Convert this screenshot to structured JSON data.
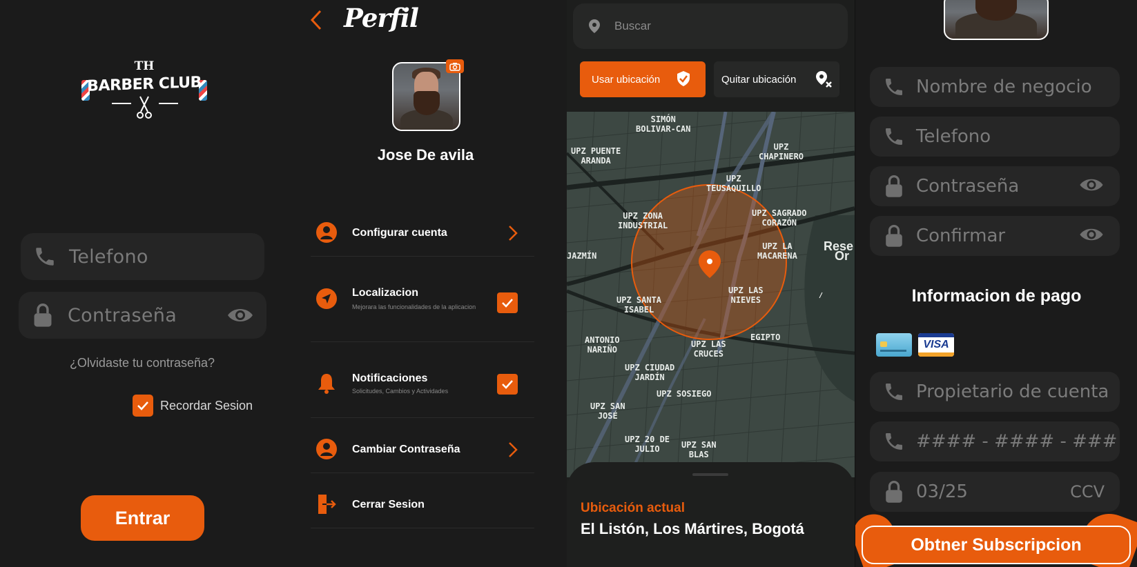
{
  "login": {
    "logo_top": "TH",
    "logo_main": "BARBER CLUB",
    "phone_placeholder": "Telefono",
    "password_placeholder": "Contraseña",
    "forgot_password": "¿Olvidaste tu contraseña?",
    "remember_label": "Recordar Sesion",
    "remember_checked": true,
    "enter_button": "Entrar"
  },
  "profile": {
    "title": "Perfil",
    "user_name": "Jose De avila",
    "menu": [
      {
        "title": "Configurar cuenta",
        "subtitle": "",
        "icon": "user-circle-icon",
        "control": "chevron"
      },
      {
        "title": "Localizacion",
        "subtitle": "Mejorara las funcionalidades de la aplicacion",
        "icon": "navigation-arrow-icon",
        "control": "checkbox",
        "checked": true
      },
      {
        "title": "Notificaciones",
        "subtitle": "Solicitudes, Cambios y Actividades",
        "icon": "bell-icon",
        "control": "checkbox",
        "checked": true
      },
      {
        "title": "Cambiar Contraseña",
        "subtitle": "",
        "icon": "user-circle-icon",
        "control": "chevron"
      },
      {
        "title": "Cerrar Sesion",
        "subtitle": "",
        "icon": "logout-icon",
        "control": "none"
      }
    ]
  },
  "location": {
    "search_placeholder": "Buscar",
    "use_location": "Usar ubicación",
    "remove_location": "Quitar ubicación",
    "map_labels": [
      "SIMÓN BOLIVAR-CAN",
      "UPZ PUENTE ARANDA",
      "UPZ CHAPINERO",
      "UPZ TEUSAQUILLO",
      "UPZ ZONA INDUSTRIAL",
      "UPZ SAGRADO CORAZÓN",
      "UPZ LA MACARENA",
      "JAZMÍN",
      "UPZ SANTA ISABEL",
      "UPZ LAS NIEVES",
      "ANTONIO NARIÑO",
      "UPZ LAS CRUCES",
      "EGIPTO",
      "UPZ CIUDAD JARDÍN",
      "UPZ SOSIEGO",
      "UPZ SAN JOSÉ",
      "UPZ 20 DE JULIO",
      "UPZ SAN BLAS",
      "Rese",
      "Or"
    ],
    "current_label": "Ubicación actual",
    "current_address": "El Listón, Los Mártires, Bogotá"
  },
  "register": {
    "business_placeholder": "Nombre de negocio",
    "phone_placeholder": "Telefono",
    "password_placeholder": "Contraseña",
    "confirm_placeholder": "Confirmar",
    "payment_title": "Informacion de pago",
    "card_brand": "VISA",
    "owner_placeholder": "Propietario de cuenta",
    "card_number_placeholder": "#### - #### - ###",
    "expiry_placeholder": "03/25",
    "ccv_placeholder": "CCV",
    "subscribe_button": "Obtner Subscripcion"
  },
  "colors": {
    "accent": "#e85c0d",
    "background": "#1b1b1b",
    "field": "#262626"
  }
}
